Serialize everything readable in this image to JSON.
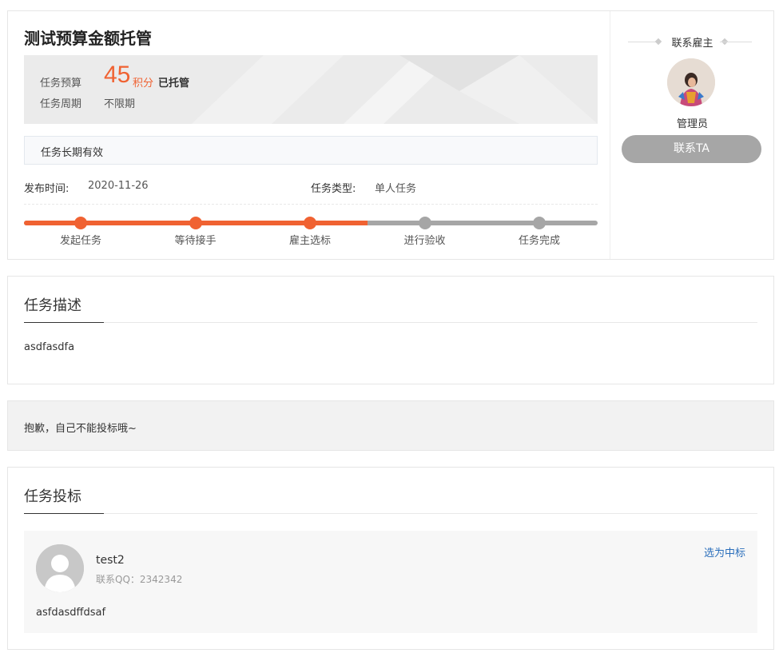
{
  "task": {
    "title": "测试预算金额托管",
    "budget_label": "任务预算",
    "budget_amount": "45",
    "budget_unit": "积分",
    "budget_status": "已托管",
    "period_label": "任务周期",
    "period_value": "不限期",
    "validity": "任务长期有效",
    "publish_label": "发布时间:",
    "publish_value": "2020-11-26",
    "type_label": "任务类型:",
    "type_value": "单人任务"
  },
  "progress": {
    "current_step": 3,
    "total_steps": 5,
    "steps": [
      "发起任务",
      "等待接手",
      "雇主选标",
      "进行验收",
      "任务完成"
    ],
    "colors": {
      "done": "#f06232",
      "todo": "#a6a6a6"
    }
  },
  "employer": {
    "heading": "联系雇主",
    "name": "管理员",
    "contact_button": "联系TA"
  },
  "description": {
    "title": "任务描述",
    "text": "asdfasdfa"
  },
  "notice": {
    "text": "抱歉，自己不能投标哦~"
  },
  "bids": {
    "title": "任务投标",
    "items": [
      {
        "name": "test2",
        "qq": "联系QQ：2342342",
        "content": "asfdasdffdsaf",
        "action": "选为中标"
      }
    ]
  }
}
